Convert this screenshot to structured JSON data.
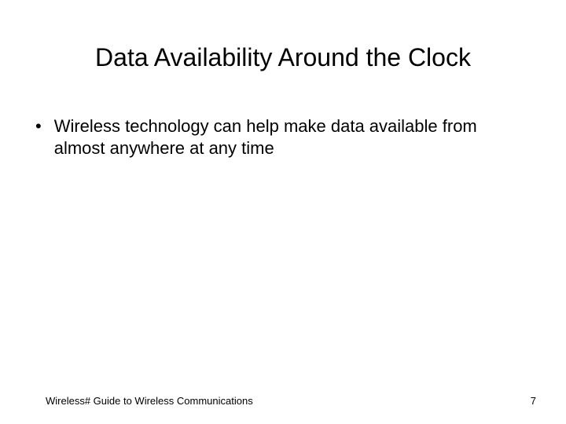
{
  "slide": {
    "title": "Data Availability Around the Clock",
    "bullets": [
      {
        "marker": "•",
        "text": "Wireless technology can help make data available from almost anywhere at any time"
      }
    ],
    "footer": {
      "left": "Wireless# Guide to Wireless Communications",
      "page_number": "7"
    }
  }
}
